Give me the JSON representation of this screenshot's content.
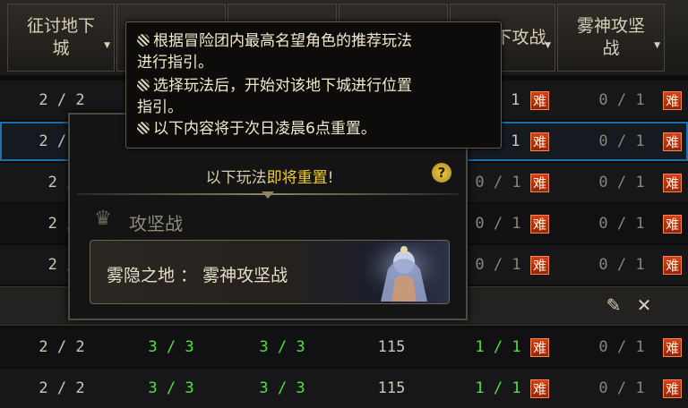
{
  "columns": {
    "c1": "征讨地下城",
    "c2": "",
    "c3": "",
    "c4": "",
    "c5": "下攻战",
    "c6": "雾神攻坚战"
  },
  "rows": [
    {
      "c1": "2 / 2",
      "c2": "",
      "c3": "",
      "c4": "",
      "c5": "/ 1",
      "c6": "0 / 1"
    },
    {
      "c1": "2 / 2",
      "c2": "",
      "c3": "",
      "c4": "",
      "c5": "/ 1",
      "c6": "0 / 1"
    },
    {
      "c1": "2 /",
      "c2": "",
      "c3": "",
      "c4": "",
      "c5": "0 / 1",
      "c6": "0 / 1"
    },
    {
      "c1": "2 /",
      "c2": "",
      "c3": "",
      "c4": "",
      "c5": "0 / 1",
      "c6": "0 / 1"
    },
    {
      "c1": "2 /",
      "c2": "",
      "c3": "",
      "c4": "",
      "c5": "0 / 1",
      "c6": "0 / 1"
    },
    {
      "c1": "2 / 2",
      "c2": "3 / 3",
      "c3": "3 / 3",
      "c4": "115",
      "c5": "1 / 1",
      "c6": "0 / 1"
    },
    {
      "c1": "2 / 2",
      "c2": "3 / 3",
      "c3": "3 / 3",
      "c4": "115",
      "c5": "1 / 1",
      "c6": "0 / 1"
    }
  ],
  "difficulty_badge": "难",
  "tooltip": {
    "line1": "根据冒险团内最高名望角色的推荐玩法",
    "line2": "进行指引。",
    "line3": "选择玩法后，开始对该地下城进行位置",
    "line4": "指引。",
    "line5": "以下内容将于次日凌晨6点重置。"
  },
  "popup": {
    "title_prefix": "以下玩法",
    "title_highlight": "即将重置",
    "title_suffix": "!",
    "help": "?",
    "category": "攻坚战",
    "entry": "雾隐之地 ： 雾神攻坚战"
  },
  "icons": {
    "help": "question-icon",
    "category": "raid-emblem-icon",
    "edit": "pencil-icon",
    "close": "close-icon",
    "bullet": "bullet-icon"
  },
  "colors": {
    "green": "#4fe13b",
    "gold_highlight": "#f2cc2e",
    "badge": "#c9351a",
    "selection": "#1f6fa8"
  }
}
